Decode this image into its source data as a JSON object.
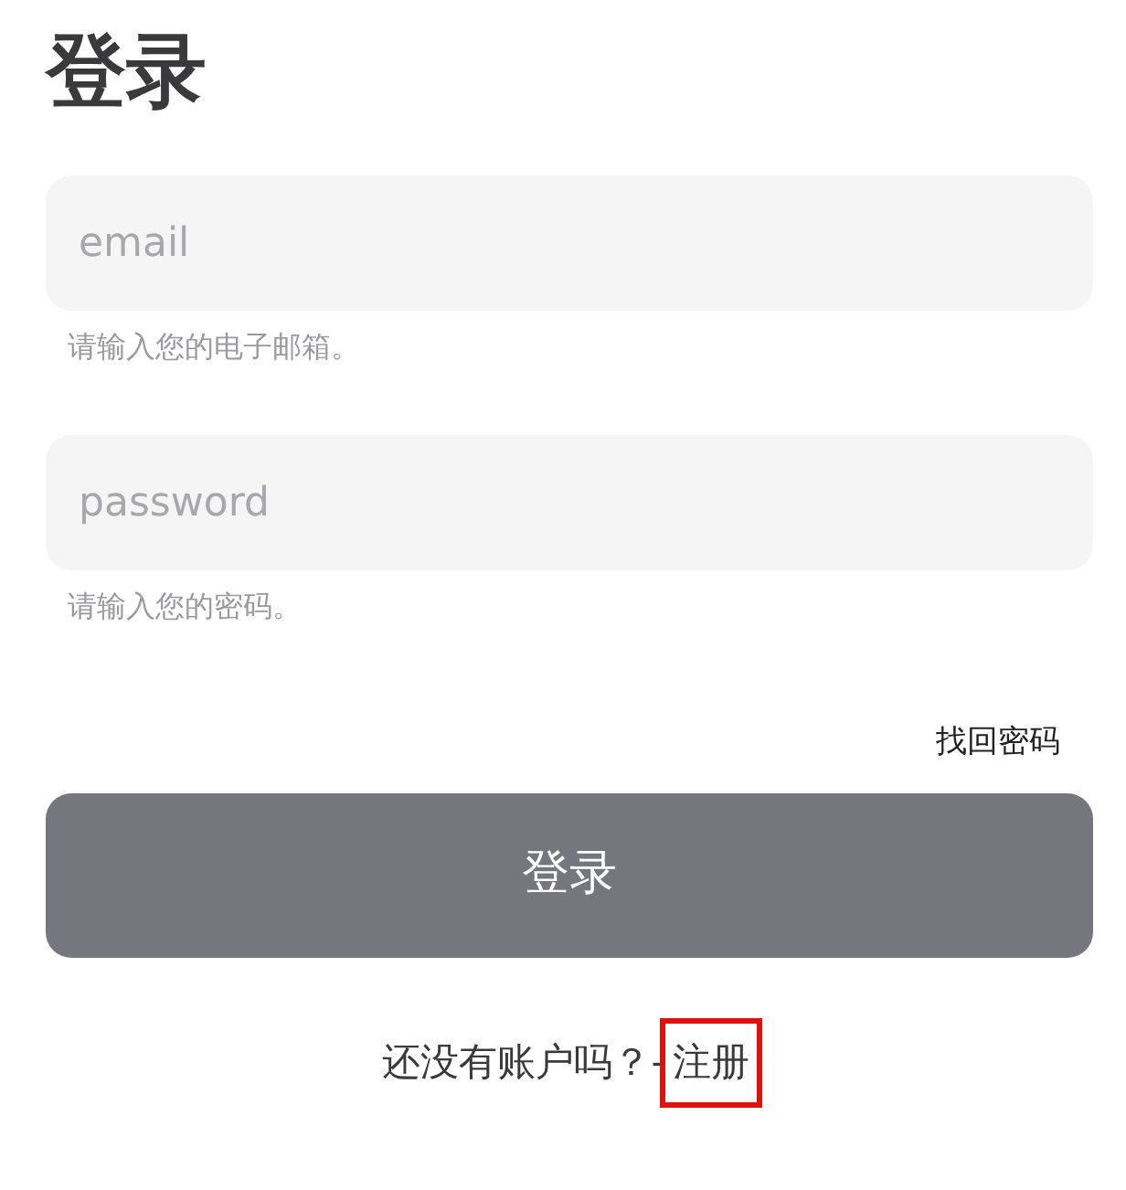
{
  "title": "登录",
  "fields": [
    {
      "placeholder": "email",
      "hint": "请输入您的电子邮箱。"
    },
    {
      "placeholder": "password",
      "hint": "请输入您的密码。"
    }
  ],
  "forgot_link": "找回密码",
  "submit_button": "登录",
  "register_prompt": "还没有账户吗？-",
  "register_link": {
    "label": "注册",
    "highlighted": true
  }
}
